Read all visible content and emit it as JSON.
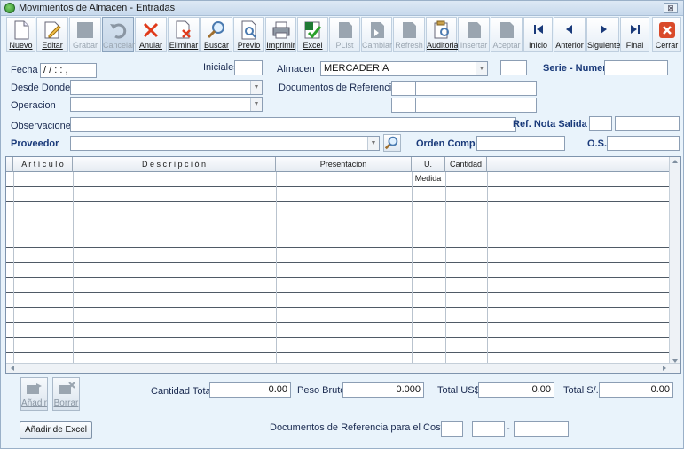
{
  "window": {
    "title": "Movimientos de Almacen - Entradas",
    "close_label": "⊠"
  },
  "toolbar": {
    "nuevo": "Nuevo",
    "editar": "Editar",
    "grabar": "Grabar",
    "cancelar": "Cancelar",
    "anular": "Anular",
    "eliminar": "Eliminar",
    "buscar": "Buscar",
    "previo": "Previo",
    "imprimir": "Imprimir",
    "excel": "Excel",
    "plist": "PList",
    "cambiar": "Cambiar",
    "refresh": "Refresh",
    "auditoria": "Auditoria",
    "insertar": "Insertar",
    "aceptar": "Aceptar",
    "inicio": "Inicio",
    "anterior": "Anterior",
    "siguiente": "Siguiente",
    "final": "Final",
    "cerrar": "Cerrar"
  },
  "form": {
    "fecha_label": "Fecha",
    "fecha_value": " / /    : : ,",
    "iniciales_label": "Iniciales",
    "almacen_label": "Almacen",
    "almacen_value": "MERCADERIA",
    "serie_label": "Serie - Numero",
    "desde_label": "Desde Donde",
    "docref_label": "Documentos de Referencia",
    "operacion_label": "Operacion",
    "observaciones_label": "Observaciones",
    "refnota_label": "Ref. Nota Salida",
    "proveedor_label": "Proveedor",
    "orden_label": "Orden Compra",
    "os_label": "O.S."
  },
  "grid": {
    "columns": [
      "A r t í c u l o",
      "D e s c r i p c i ó n",
      "Presentacion",
      "U. Medida",
      "Cantidad"
    ]
  },
  "footer": {
    "anadir": "Añadir",
    "borrar": "Borrar",
    "cantidad_total_label": "Cantidad Total",
    "cantidad_total_value": "0.00",
    "peso_bruto_label": "Peso Bruto",
    "peso_bruto_value": "0.000",
    "total_usd_label": "Total US$",
    "total_usd_value": "0.00",
    "total_s_label": "Total S/.",
    "total_s_value": "0.00",
    "docref_costeo_label": "Documentos de Referencia para el Costeo",
    "anadir_excel": "Añadir de Excel"
  },
  "colors": {
    "background": "#e9f3fb",
    "label_blue": "#1a3a7a",
    "close_red": "#d94a2a"
  }
}
